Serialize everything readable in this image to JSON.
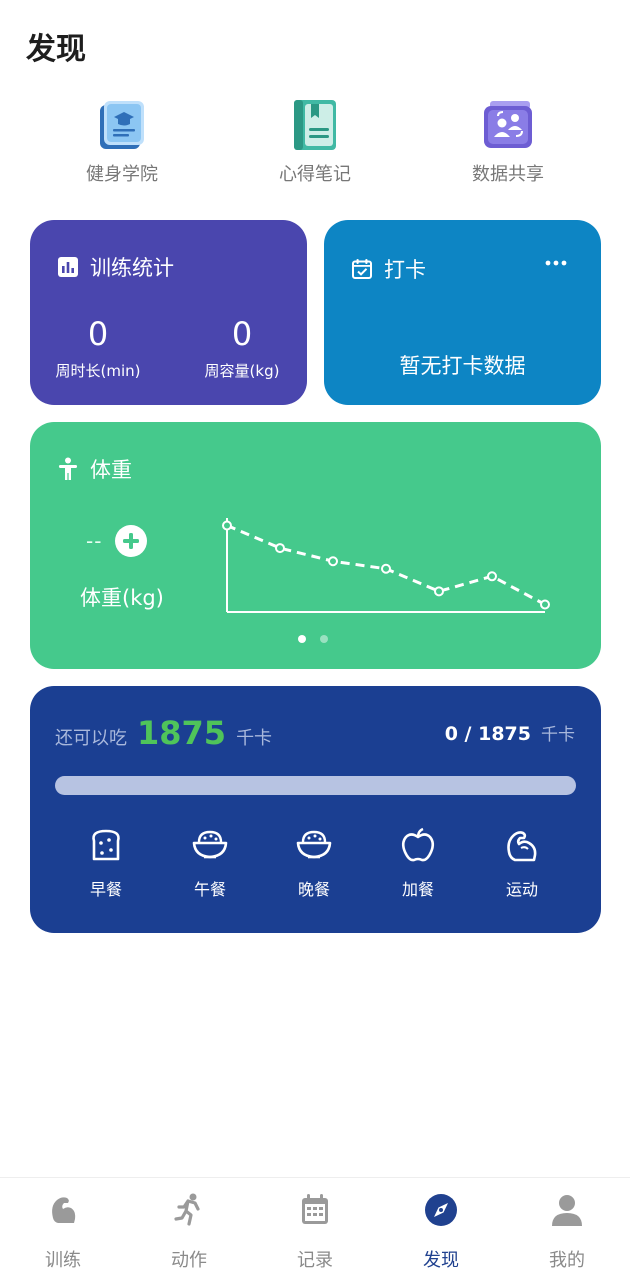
{
  "header": {
    "title": "发现"
  },
  "shortcuts": [
    {
      "label": "健身学院",
      "icon": "academy-book-icon"
    },
    {
      "label": "心得笔记",
      "icon": "notebook-icon"
    },
    {
      "label": "数据共享",
      "icon": "data-share-icon"
    }
  ],
  "training_stats": {
    "title": "训练统计",
    "icon": "bar-chart-icon",
    "weekly_duration": {
      "value": "0",
      "label": "周时长(min)"
    },
    "weekly_volume": {
      "value": "0",
      "label": "周容量(kg)"
    }
  },
  "checkin": {
    "title": "打卡",
    "icon": "calendar-check-icon",
    "empty_text": "暂无打卡数据"
  },
  "weight": {
    "title": "体重",
    "icon": "person-icon",
    "value": "--",
    "label": "体重(kg)",
    "trend": [
      0.92,
      0.68,
      0.54,
      0.46,
      0.22,
      0.38,
      0.08
    ],
    "page_count": 2,
    "active_page": 0
  },
  "diet": {
    "remaining_label": "还可以吃",
    "remaining_value": "1875",
    "unit": "千卡",
    "consumed": "0 / 1875",
    "progress": 0,
    "meals": [
      {
        "label": "早餐",
        "icon": "toast-icon"
      },
      {
        "label": "午餐",
        "icon": "rice-bowl-icon"
      },
      {
        "label": "晚餐",
        "icon": "rice-bowl-icon"
      },
      {
        "label": "加餐",
        "icon": "apple-icon"
      },
      {
        "label": "运动",
        "icon": "muscle-icon"
      }
    ]
  },
  "tabbar": {
    "active": 3,
    "items": [
      {
        "label": "训练",
        "icon": "training-icon"
      },
      {
        "label": "动作",
        "icon": "running-icon"
      },
      {
        "label": "记录",
        "icon": "calendar-icon"
      },
      {
        "label": "发现",
        "icon": "compass-icon"
      },
      {
        "label": "我的",
        "icon": "user-icon"
      }
    ]
  },
  "colors": {
    "training_card": "#4a46ae",
    "checkin_card": "#0d85c4",
    "weight_card": "#45c98c",
    "diet_card": "#1b3f92",
    "accent_green": "#4fc45a",
    "tab_active": "#20418f",
    "tab_inactive": "#8a8a8a"
  }
}
